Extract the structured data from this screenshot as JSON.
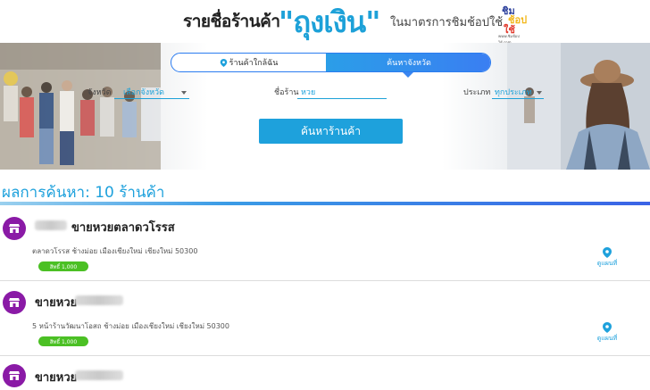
{
  "header": {
    "title": "รายชื่อร้านค้า",
    "highlight": "\"ถุงเงิน\"",
    "tagline": "ในมาตรการชิมช้อปใช้",
    "logo": {
      "line1": "ชิม",
      "line2": "ช้อป",
      "line3": "ใช้",
      "line4": "www.ชิมช้อปใช้.com"
    }
  },
  "search": {
    "tab_nearby": "ร้านค้าใกล้ฉัน",
    "tab_province": "ค้นหาจังหวัด",
    "province_label": "จังหวัด",
    "province_value": "เลือกจังหวัด",
    "shop_name_label": "ชื่อร้าน",
    "shop_name_value": "หวย",
    "category_label": "ประเภท",
    "category_value": "ทุกประเภท",
    "submit_label": "ค้นหาร้านค้า"
  },
  "results": {
    "title": "ผลการค้นหา: 10 ร้านค้า",
    "map_label": "ดูแผนที่",
    "items": [
      {
        "title": "ขายหวยตลาดวโรรส",
        "address": "ตลาดวโรรส ช้างม่อย เมืองเชียงใหม่ เชียงใหม่ 50300",
        "badge": "สิทธิ์ 1,000"
      },
      {
        "title": "ขายหวย",
        "address": "5 หน้าร้านวัฒนาโอสถ ช้างม่อย เมืองเชียงใหม่ เชียงใหม่ 50300",
        "badge": "สิทธิ์ 1,000"
      },
      {
        "title": "ขายหวย",
        "address": "",
        "badge": ""
      }
    ]
  },
  "colors": {
    "accent": "#1ea1dc",
    "store_icon": "#8a1aa6",
    "badge": "#4bc024"
  },
  "icons": {
    "store": "store-icon",
    "pin": "map-pin-icon",
    "location": "location-pin-icon"
  }
}
